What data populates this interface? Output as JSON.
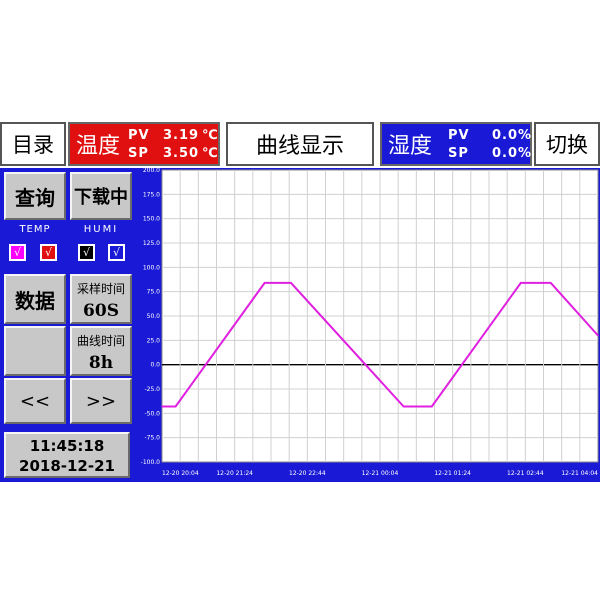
{
  "header": {
    "menu_label": "目录",
    "title": "曲线显示",
    "switch_label": "切换",
    "temperature": {
      "label": "温度",
      "pv_tag": "PV",
      "pv_value": "3.19",
      "sp_tag": "SP",
      "sp_value": "3.50",
      "unit": "℃",
      "color": "#e01010"
    },
    "humidity": {
      "label": "湿度",
      "pv_tag": "PV",
      "pv_value": "0.0",
      "sp_tag": "SP",
      "sp_value": "0.0",
      "unit": "%",
      "color": "#1a1ad6"
    }
  },
  "sidebar": {
    "query_label": "查询",
    "downloading_label": "下载中",
    "temp_tag": "TEMP",
    "humi_tag": "HUMI",
    "check_glyph": "√",
    "data_label": "数据",
    "sample_time_label": "采样时间",
    "sample_time_value": "60S",
    "curve_time_label": "曲线时间",
    "curve_time_value": "8h",
    "prev_label": "<<",
    "next_label": ">>",
    "clock_time": "11:45:18",
    "clock_date": "2018-12-21"
  },
  "colors": {
    "panel_blue": "#1a1ad6",
    "temp_curve": "#e020e0",
    "temp_red": "#e01010",
    "magenta": "#ff00ff"
  },
  "chart_data": {
    "type": "line",
    "title": "",
    "xlabel": "",
    "ylabel": "",
    "ylim": [
      -100,
      200
    ],
    "y_ticks": [
      "200.0",
      "175.0",
      "150.0",
      "125.0",
      "100.0",
      "75.0",
      "50.0",
      "25.0",
      "0.0",
      "-25.0",
      "-50.0",
      "-75.0",
      "-100.0"
    ],
    "x_ticks": [
      "12-20 20:04",
      "12-20 21:24",
      "12-20 22:44",
      "12-21 00:04",
      "12-21 01:24",
      "12-21 02:44",
      "12-21 04:04"
    ],
    "grid": true,
    "series": [
      {
        "values_x": [
          "12-20 20:04",
          "12-20 20:19",
          "12-20 21:57",
          "12-20 22:26",
          "12-21 00:30",
          "12-21 01:01",
          "12-21 02:39",
          "12-21 03:12",
          "12-21 04:04"
        ],
        "values": [
          -43,
          -43,
          84,
          84,
          -43,
          -43,
          84,
          84,
          30
        ]
      }
    ]
  }
}
